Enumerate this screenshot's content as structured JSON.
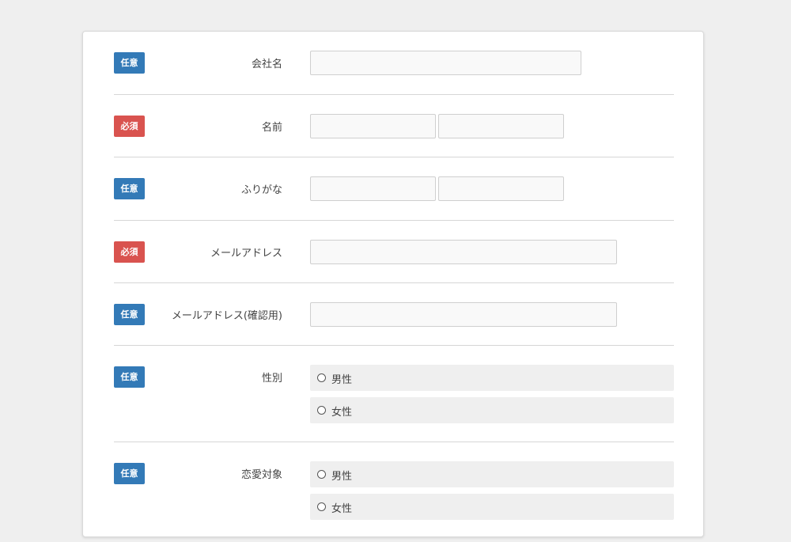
{
  "badges": {
    "optional": "任意",
    "required": "必須"
  },
  "fields": {
    "company": {
      "label": "会社名"
    },
    "name": {
      "label": "名前"
    },
    "furigana": {
      "label": "ふりがな"
    },
    "email": {
      "label": "メールアドレス"
    },
    "email_confirm": {
      "label": "メールアドレス(確認用)"
    },
    "gender": {
      "label": "性別",
      "options": [
        "男性",
        "女性"
      ]
    },
    "romance_target": {
      "label": "恋愛対象",
      "options": [
        "男性",
        "女性"
      ]
    }
  },
  "colors": {
    "optional_badge": "#337ab7",
    "required_badge": "#d9534f",
    "page_background": "#efefef"
  }
}
